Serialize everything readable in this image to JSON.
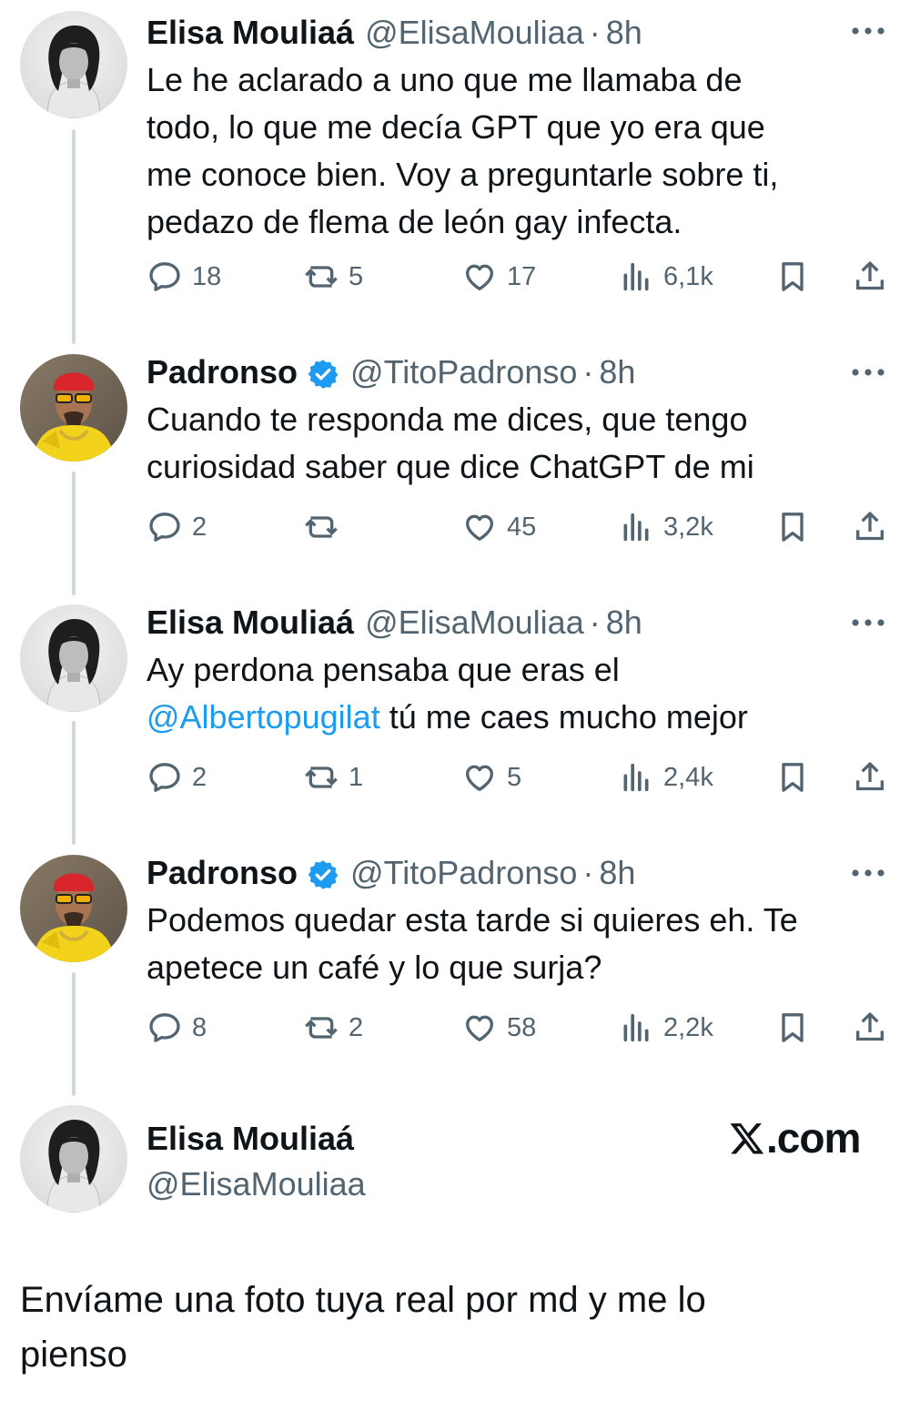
{
  "tweets": [
    {
      "name": "Elisa Mouliaá",
      "handle": "@ElisaMouliaa",
      "separator": "·",
      "time": "8h",
      "verified": false,
      "text_lines": [
        "Le he aclarado a uno que me llamaba de",
        "todo, lo que me decía GPT que yo era que",
        "me conoce bien. Voy a preguntarle sobre ti,",
        "pedazo de flema de león gay infecta."
      ],
      "replies": "18",
      "reposts": "5",
      "likes": "17",
      "views": "6,1k"
    },
    {
      "name": "Padronso",
      "handle": "@TitoPadronso",
      "separator": "·",
      "time": "8h",
      "verified": true,
      "text_lines": [
        "Cuando te responda me dices, que tengo",
        "curiosidad saber que dice ChatGPT de mi"
      ],
      "replies": "2",
      "reposts": "",
      "likes": "45",
      "views": "3,2k"
    },
    {
      "name": "Elisa Mouliaá",
      "handle": "@ElisaMouliaa",
      "separator": "·",
      "time": "8h",
      "verified": false,
      "text_line1": "Ay perdona pensaba que eras el",
      "mention": "@Albertopugilat",
      "text_after_mention": " tú me caes mucho mejor",
      "replies": "2",
      "reposts": "1",
      "likes": "5",
      "views": "2,4k"
    },
    {
      "name": "Padronso",
      "handle": "@TitoPadronso",
      "separator": "·",
      "time": "8h",
      "verified": true,
      "text_lines": [
        "Podemos quedar esta tarde si quieres eh. Te",
        "apetece un café y lo que surja?"
      ],
      "replies": "8",
      "reposts": "2",
      "likes": "58",
      "views": "2,2k"
    }
  ],
  "final_tweet": {
    "name": "Elisa Mouliaá",
    "handle": "@ElisaMouliaa",
    "brand": ".com",
    "text_lines": [
      "Envíame una foto tuya real por md y me lo",
      "pienso"
    ]
  },
  "icons": [
    "reply-icon",
    "repost-icon",
    "like-icon",
    "views-icon",
    "bookmark-icon",
    "share-icon",
    "more-icon",
    "verified-badge-icon",
    "x-logo-icon"
  ],
  "colors": {
    "text": "#0f1419",
    "muted": "#536471",
    "link": "#1d9bf0",
    "verified": "#1d9bf0",
    "thread_line": "#cfd9de"
  }
}
